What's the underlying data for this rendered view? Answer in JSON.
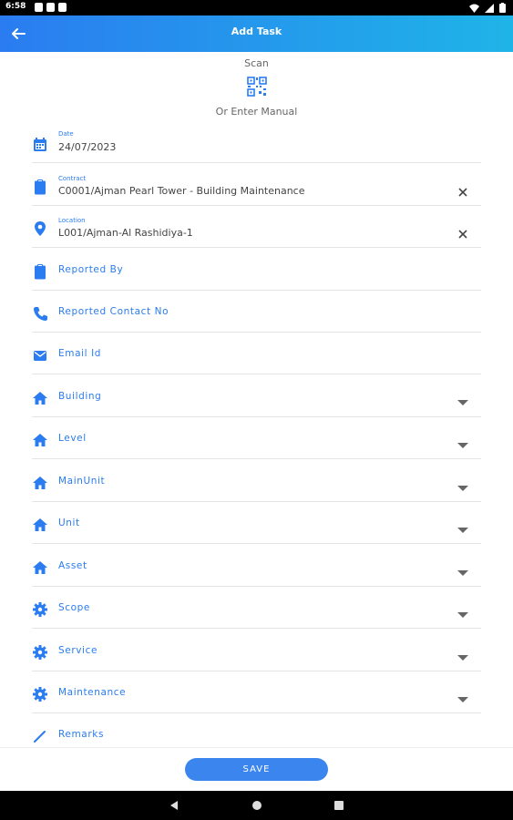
{
  "status_bar": {
    "time": "6:58"
  },
  "app_bar": {
    "title": "Add Task",
    "back_icon": "arrow-left-icon"
  },
  "scan": {
    "label": "Scan",
    "icon": "qr-code-icon",
    "or_label": "Or Enter Manual"
  },
  "fields": [
    {
      "label": "Date",
      "value": "24/07/2023",
      "icon": "calendar-icon"
    },
    {
      "label": "Contract",
      "value": "C0001/Ajman Pearl Tower - Building Maintenance",
      "icon": "clipboard-icon"
    },
    {
      "label": "Location",
      "value": "L001/Ajman-Al Rashidiya-1",
      "icon": "location-pin-icon"
    },
    {
      "label": "Reported By",
      "icon": "clipboard-icon"
    },
    {
      "label": "Reported Contact No",
      "icon": "phone-icon"
    },
    {
      "label": "Email Id",
      "icon": "mail-icon"
    },
    {
      "label": "Building",
      "icon": "home-icon"
    },
    {
      "label": "Level",
      "icon": "home-icon"
    },
    {
      "label": "MainUnit",
      "icon": "home-icon"
    },
    {
      "label": "Unit",
      "icon": "home-icon"
    },
    {
      "label": "Asset",
      "icon": "home-icon"
    },
    {
      "label": "Scope",
      "icon": "gear-icon"
    },
    {
      "label": "Service",
      "icon": "gear-icon"
    },
    {
      "label": "Maintenance",
      "icon": "gear-icon"
    },
    {
      "label": "Remarks",
      "icon": "pencil-icon"
    }
  ],
  "save_label": "SAVE",
  "colors": {
    "accent": "#2a7cf0",
    "appbar_end": "#1fb4e8",
    "save_button": "#3b86ee"
  }
}
